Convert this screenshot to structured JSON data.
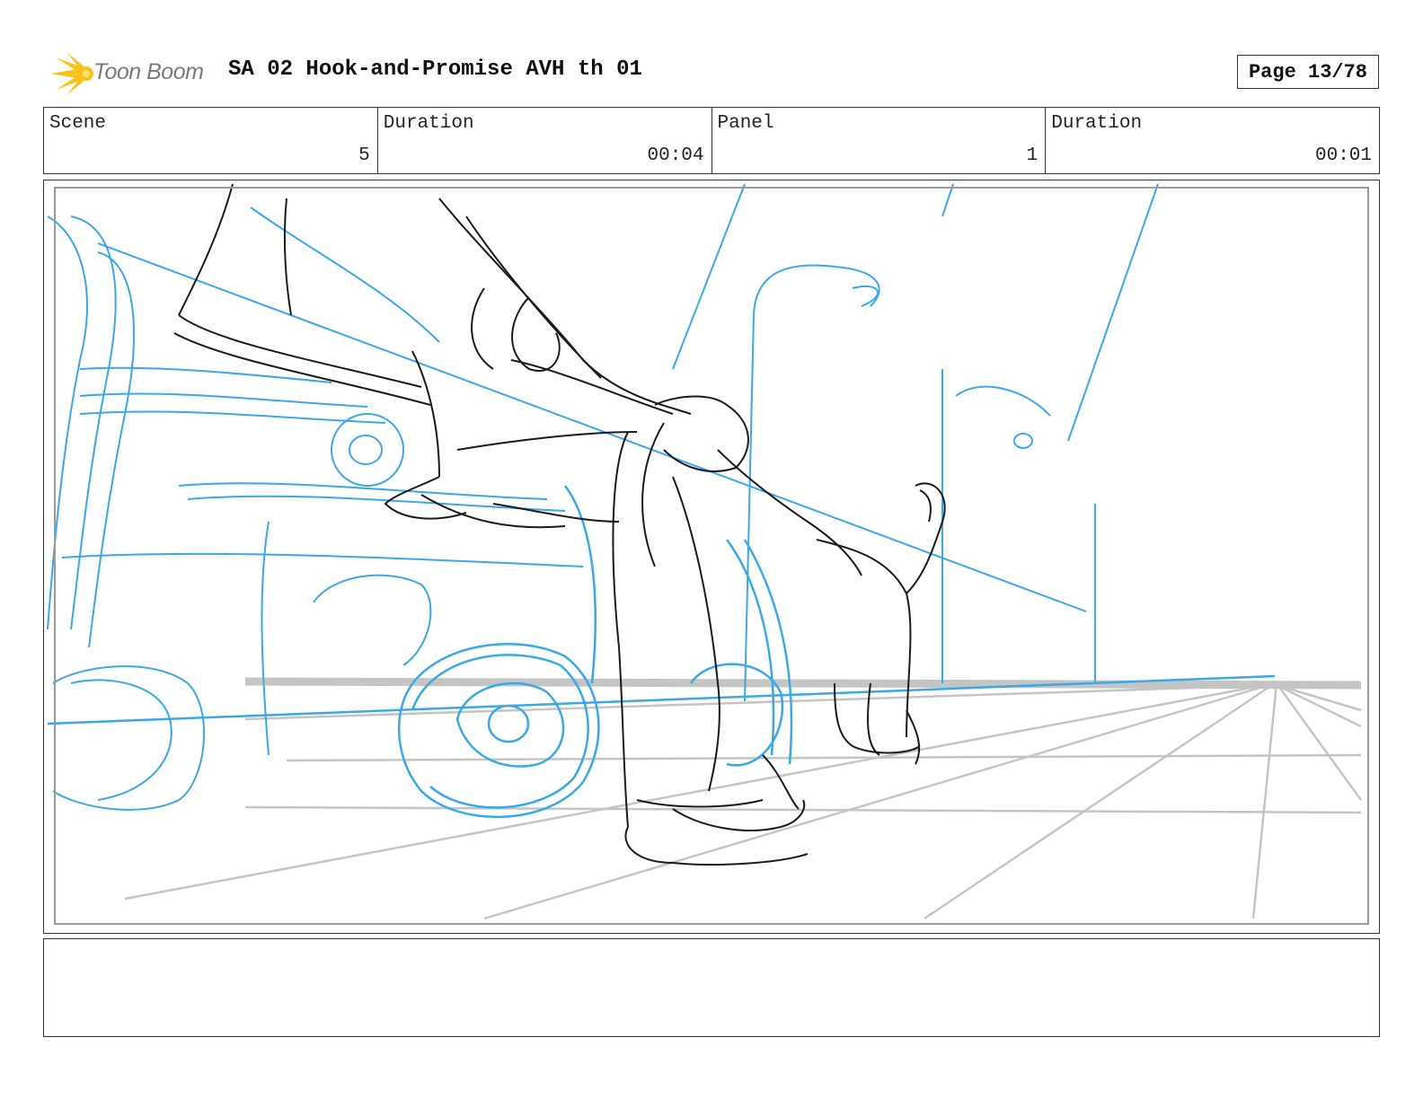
{
  "header": {
    "logo_text": "Toon Boom",
    "title": "SA 02 Hook-and-Promise AVH th 01",
    "page_label": "Page 13/78"
  },
  "info": {
    "scene_label": "Scene",
    "scene_value": "5",
    "scene_duration_label": "Duration",
    "scene_duration_value": "00:04",
    "panel_label": "Panel",
    "panel_value": "1",
    "panel_duration_label": "Duration",
    "panel_duration_value": "00:01"
  },
  "colors": {
    "sketch_black": "#1a1a1a",
    "sketch_blue": "#3aa8e6",
    "perspective_grey": "#c4c4c4",
    "logo_yellow": "#f7c21b"
  },
  "notes": {
    "text": ""
  }
}
